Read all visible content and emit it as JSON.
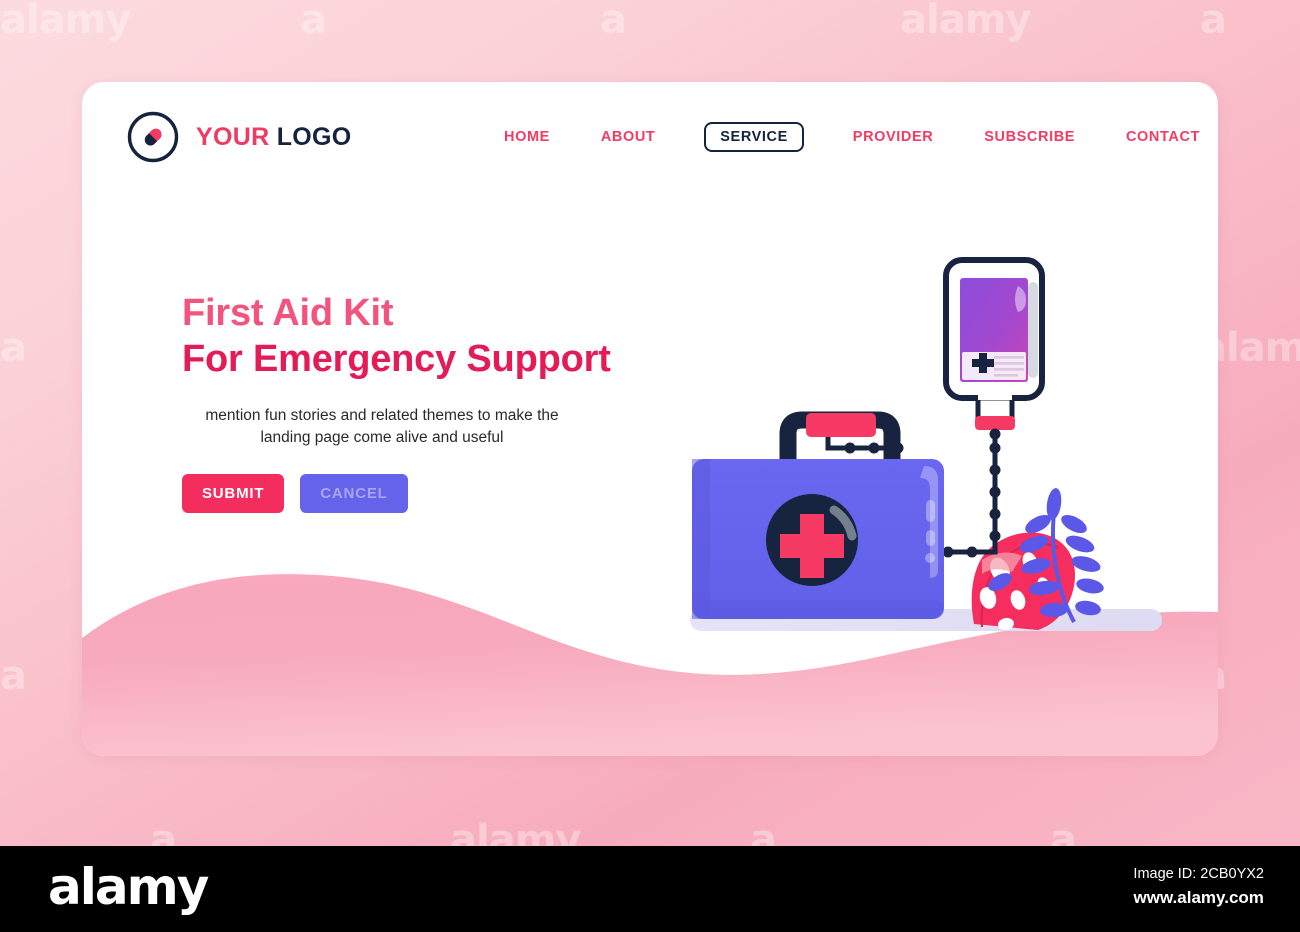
{
  "brand": {
    "word_1": "YOUR",
    "word_2": "LOGO",
    "logo_icon": "pill-capsule-in-circle-icon"
  },
  "nav": {
    "items": [
      {
        "label": "HOME",
        "active": false
      },
      {
        "label": "ABOUT",
        "active": false
      },
      {
        "label": "SERVICE",
        "active": true
      },
      {
        "label": "PROVIDER",
        "active": false
      },
      {
        "label": "SUBSCRIBE",
        "active": false
      },
      {
        "label": "CONTACT",
        "active": false
      }
    ]
  },
  "hero": {
    "headline_line1": "First Aid Kit",
    "headline_line2": "For Emergency Support",
    "description": "mention fun stories and related themes to make the landing page come alive and useful",
    "submit_label": "SUBMIT",
    "cancel_label": "CANCEL"
  },
  "illustration": {
    "name": "first-aid-kit-with-iv-drip-illustration",
    "elements": [
      "first-aid-kit-case",
      "kit-handle",
      "medical-cross-emblem",
      "iv-bag",
      "iv-tube",
      "monstera-leaf",
      "fern-leaf",
      "ground-shadow"
    ]
  },
  "colors": {
    "accent_pink": "#f32e5f",
    "nav_pink": "#f33b63",
    "headline_light": "#f3537c",
    "headline_dark": "#e31b56",
    "navy": "#15233c",
    "purple_button": "#6563ea",
    "kit_purple": "#6563ea",
    "iv_purple": "#9a43c9",
    "page_background": "#f9bcc8",
    "card_background": "#ffffff"
  },
  "watermark": {
    "tile_text": "alamy",
    "letter": "a"
  },
  "footer": {
    "logo": "alamy",
    "image_id": "Image ID: 2CB0YX2",
    "url": "www.alamy.com"
  }
}
